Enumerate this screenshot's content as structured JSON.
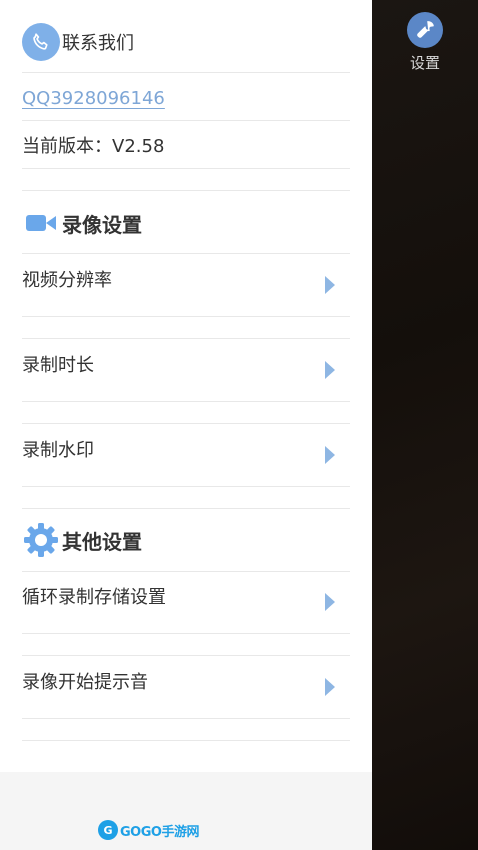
{
  "contact": {
    "title": "联系我们",
    "qq": "QQ3928096146",
    "version": "当前版本：V2.58"
  },
  "video_settings": {
    "title": "录像设置",
    "items": [
      {
        "label": "视频分辨率"
      },
      {
        "label": "录制时长"
      },
      {
        "label": "录制水印"
      }
    ]
  },
  "other_settings": {
    "title": "其他设置",
    "items": [
      {
        "label": "循环录制存储设置"
      },
      {
        "label": "录像开始提示音"
      }
    ]
  },
  "right_pane": {
    "settings_label": "设置"
  },
  "footer": {
    "logo_mark": "G",
    "logo_text": "GOGO手游网"
  },
  "colors": {
    "accent": "#7fb0e8",
    "link": "#7ea6d6",
    "arrow": "#8eb6e3",
    "launcher": "#5b87c7"
  }
}
